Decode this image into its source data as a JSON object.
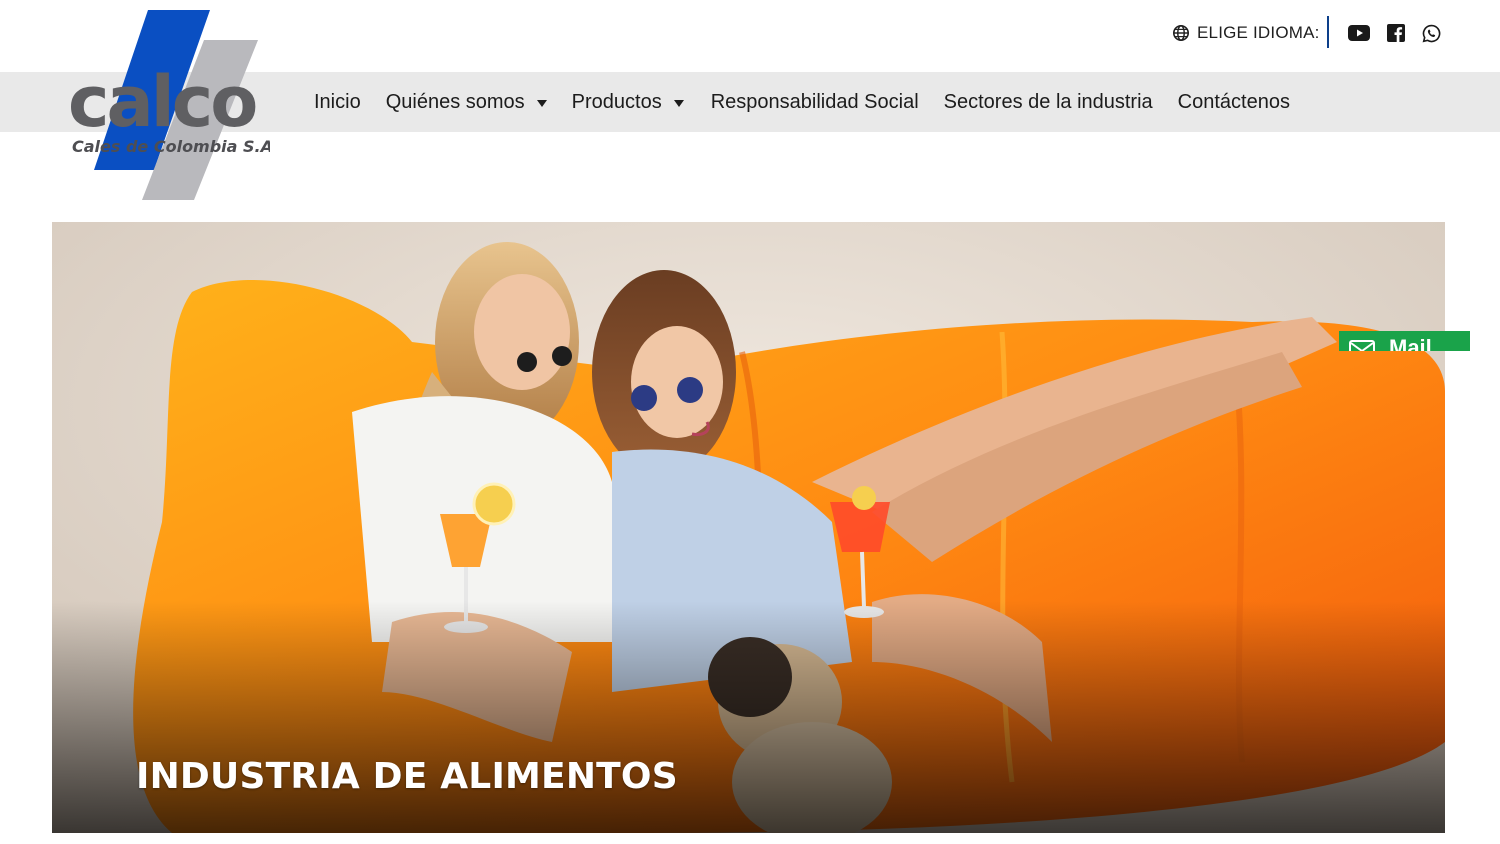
{
  "header": {
    "language_label": "ELIGE IDIOMA:",
    "social": [
      "youtube-icon",
      "facebook-icon",
      "whatsapp-icon"
    ]
  },
  "logo": {
    "wordmark": "calco",
    "tagline": "Cales de Colombia S.A."
  },
  "nav": {
    "items": [
      {
        "label": "Inicio",
        "has_dropdown": false
      },
      {
        "label": "Quiénes somos",
        "has_dropdown": true
      },
      {
        "label": "Productos",
        "has_dropdown": true
      },
      {
        "label": "Responsabilidad Social",
        "has_dropdown": false
      },
      {
        "label": "Sectores de la industria",
        "has_dropdown": false
      },
      {
        "label": "Contáctenos",
        "has_dropdown": false
      }
    ]
  },
  "hero": {
    "title": "INDUSTRIA DE ALIMENTOS",
    "image": "two-women-on-orange-air-lounger-beach-with-pug"
  },
  "mail_tab": {
    "label": "Mail",
    "icon": "envelope-icon"
  },
  "colors": {
    "brand_blue": "#0a4fc2",
    "logo_gray": "#6a6a6a",
    "nav_bg": "#e9e9e9",
    "accent_green": "#1aa34a",
    "divider_blue": "#0d3f8a"
  }
}
